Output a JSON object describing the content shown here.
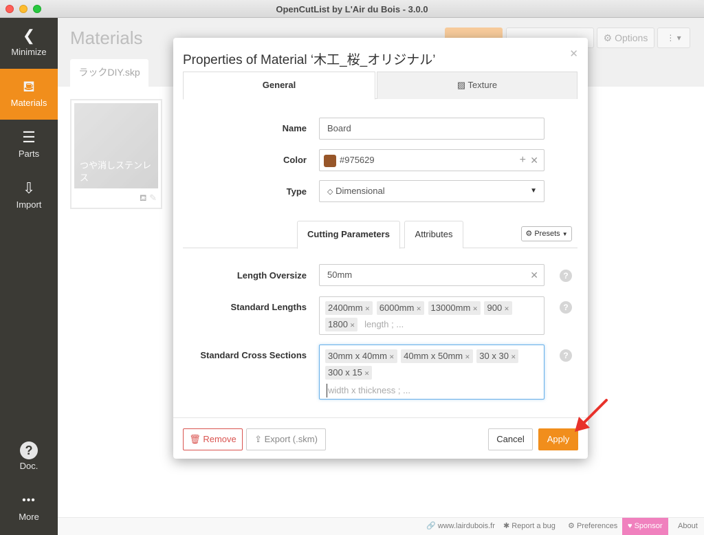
{
  "window": {
    "title": "OpenCutList by L'Air du Bois - 3.0.0"
  },
  "sidebar": {
    "items": [
      {
        "label": "Minimize",
        "icon": "chevron-left-icon",
        "glyph": "❮"
      },
      {
        "label": "Materials",
        "icon": "paint-bucket-icon",
        "glyph": "⛾"
      },
      {
        "label": "Parts",
        "icon": "list-icon",
        "glyph": "☰"
      },
      {
        "label": "Import",
        "icon": "import-icon",
        "glyph": "⇩"
      },
      {
        "label": "Doc.",
        "icon": "help-icon",
        "glyph": "?"
      },
      {
        "label": "More",
        "icon": "more-icon",
        "glyph": "•••"
      }
    ],
    "active_color": "#f18e1c"
  },
  "main": {
    "title": "Materials",
    "file_tab": "ラックDIY.skp",
    "options_label": "⚙ Options",
    "more_label": "⋮ ▾",
    "material_card": {
      "name": "つや消しステンレス"
    }
  },
  "footer": {
    "website": "www.lairdubois.fr",
    "report_bug": "Report a bug",
    "preferences": "Preferences",
    "sponsor": "Sponsor",
    "about": "About"
  },
  "dialog": {
    "title": "Properties of Material ‘木工_桜_オリジナル’",
    "tabs": [
      "General",
      "Texture"
    ],
    "texture_icon": "▨",
    "fields": {
      "name_label": "Name",
      "name_value": "Board",
      "color_label": "Color",
      "color_value": "#975629",
      "type_label": "Type",
      "type_value": "Dimensional"
    },
    "subtabs": [
      "Cutting Parameters",
      "Attributes"
    ],
    "presets_label": "Presets",
    "length_oversize": {
      "label": "Length Oversize",
      "value": "50mm"
    },
    "standard_lengths": {
      "label": "Standard Lengths",
      "tags": [
        "2400mm",
        "6000mm",
        "13000mm",
        "900",
        "1800"
      ],
      "placeholder": "length ; ..."
    },
    "standard_cross_sections": {
      "label": "Standard Cross Sections",
      "tags": [
        "30mm x 40mm",
        "40mm x 50mm",
        "30 x 30",
        "300 x 15"
      ],
      "placeholder": "width x thickness ; ..."
    },
    "buttons": {
      "remove": "Remove",
      "export": "Export (.skm)",
      "cancel": "Cancel",
      "apply": "Apply"
    }
  },
  "colors": {
    "accent": "#f18e1c",
    "danger": "#d9534f",
    "annotation_arrow": "#e8322b"
  }
}
